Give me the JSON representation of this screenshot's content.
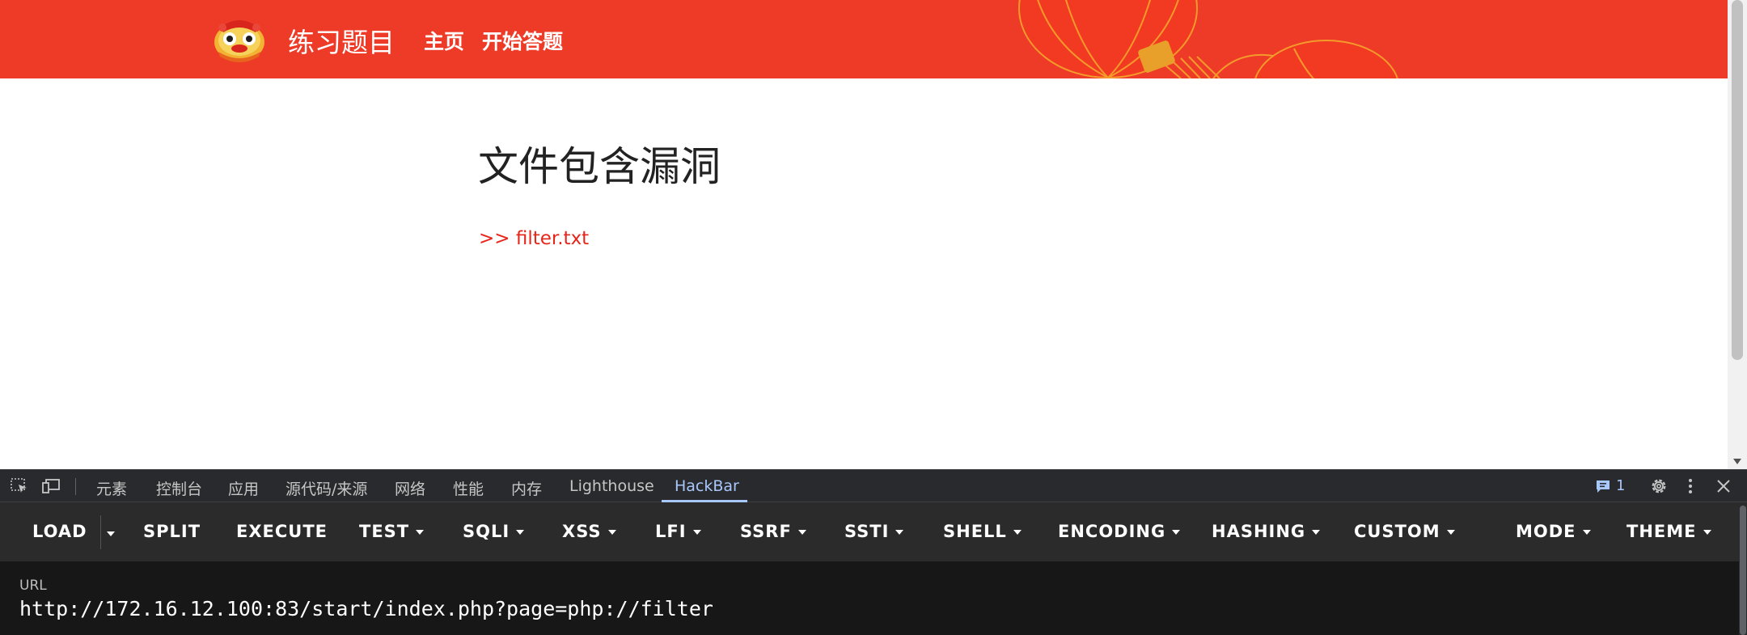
{
  "header": {
    "site_title": "练习题目",
    "nav": [
      "主页",
      "开始答题"
    ]
  },
  "content": {
    "heading": "文件包含漏洞",
    "link_text": ">> filter.txt"
  },
  "devtools": {
    "tabs": [
      "元素",
      "控制台",
      "应用",
      "源代码/来源",
      "网络",
      "性能",
      "内存",
      "Lighthouse",
      "HackBar"
    ],
    "active_tab": "HackBar",
    "issues_count": "1",
    "icons": [
      "inspect-element-icon",
      "device-toolbar-icon",
      "issues-icon",
      "settings-gear-icon",
      "more-vert-icon",
      "close-icon"
    ]
  },
  "hackbar": {
    "buttons": {
      "load": "LOAD",
      "split": "SPLIT",
      "execute": "EXECUTE",
      "test": "TEST",
      "sqli": "SQLI",
      "xss": "XSS",
      "lfi": "LFI",
      "ssrf": "SSRF",
      "ssti": "SSTI",
      "shell": "SHELL",
      "encoding": "ENCODING",
      "hashing": "HASHING",
      "custom": "CUSTOM",
      "mode": "MODE",
      "theme": "THEME"
    },
    "url_label": "URL",
    "url_value": "http://172.16.12.100:83/start/index.php?page=php://filter"
  },
  "colors": {
    "header_bg": "#ee3b28",
    "link_red": "#e8251b",
    "devtools_active": "#a8c7fa",
    "hackbar_bg": "#2b2b2b"
  }
}
